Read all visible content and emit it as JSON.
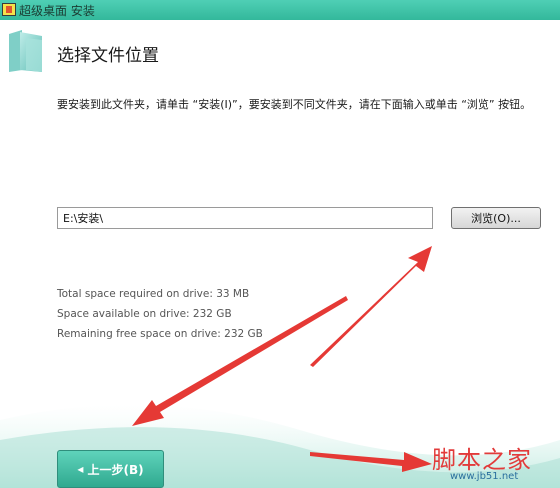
{
  "window": {
    "title": "超级桌面 安装"
  },
  "header": {
    "title": "选择文件位置"
  },
  "description": "要安装到此文件夹，请单击 “安装(I)”，要安装到不同文件夹，请在下面输入或单击 “浏览” 按钮。",
  "path_field": {
    "value": "E:\\安装\\"
  },
  "browse_button": {
    "label": "浏览(O)..."
  },
  "space": {
    "required": "Total space required on drive: 33 MB",
    "available": "Space available on drive: 232 GB",
    "remaining": "Remaining free space on drive: 232 GB"
  },
  "buttons": {
    "back": "上一步(B)"
  },
  "watermark": {
    "text": "脚本之家",
    "url": "www.jb51.net"
  },
  "icons": {
    "folder": "folder-icon",
    "back": "chevron-left-icon",
    "app": "app-icon"
  },
  "colors": {
    "titlebar": "#33b89b",
    "accent": "#2fa98f",
    "annotation_arrow": "#e53935"
  }
}
